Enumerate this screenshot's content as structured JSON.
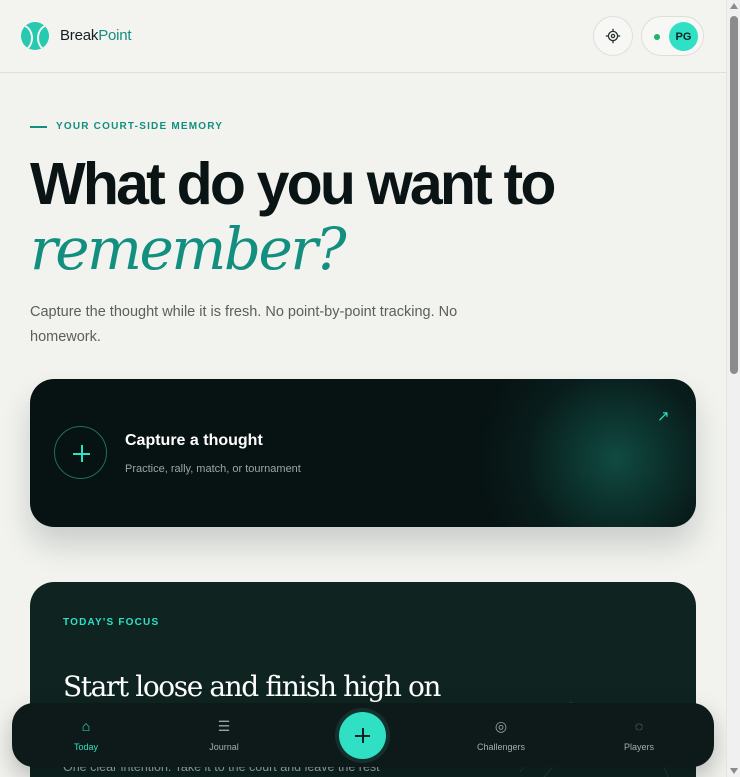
{
  "header": {
    "brand_part1": "Break",
    "brand_part2": "Point",
    "logo_icon": "tennis-ball-icon",
    "settings_icon": "gear-icon",
    "avatar_initials": "PG",
    "online_status_color": "#1db36a"
  },
  "hero": {
    "eyebrow": "YOUR COURT-SIDE MEMORY",
    "title": "What do you want to",
    "title_accent": "remember?",
    "subtitle": "Capture the thought while it is fresh. No point-by-point tracking. No homework."
  },
  "capture_card": {
    "title": "Capture a thought",
    "subtitle": "Practice, rally, match, or tournament",
    "arrow": "↗"
  },
  "focus_card": {
    "label": "TODAY'S FOCUS",
    "title": "Start loose and finish high on",
    "body": "One clear intention. Take it to the court and leave the rest"
  },
  "nav": {
    "items": [
      {
        "label": "Today",
        "icon": "⌂",
        "icon_name": "home-icon",
        "active": true
      },
      {
        "label": "Journal",
        "icon": "☰",
        "icon_name": "journal-icon",
        "active": false
      },
      {
        "label": "Challengers",
        "icon": "◎",
        "icon_name": "target-icon",
        "active": false
      },
      {
        "label": "Players",
        "icon": "◌",
        "icon_name": "players-icon",
        "active": false
      }
    ],
    "fab_icon": "plus-icon"
  },
  "colors": {
    "accent": "#2fe0c4",
    "accent_dark": "#138f7f",
    "background": "#f2f3ef",
    "card_dark": "#071212",
    "nav_bg": "#0e1a19"
  }
}
